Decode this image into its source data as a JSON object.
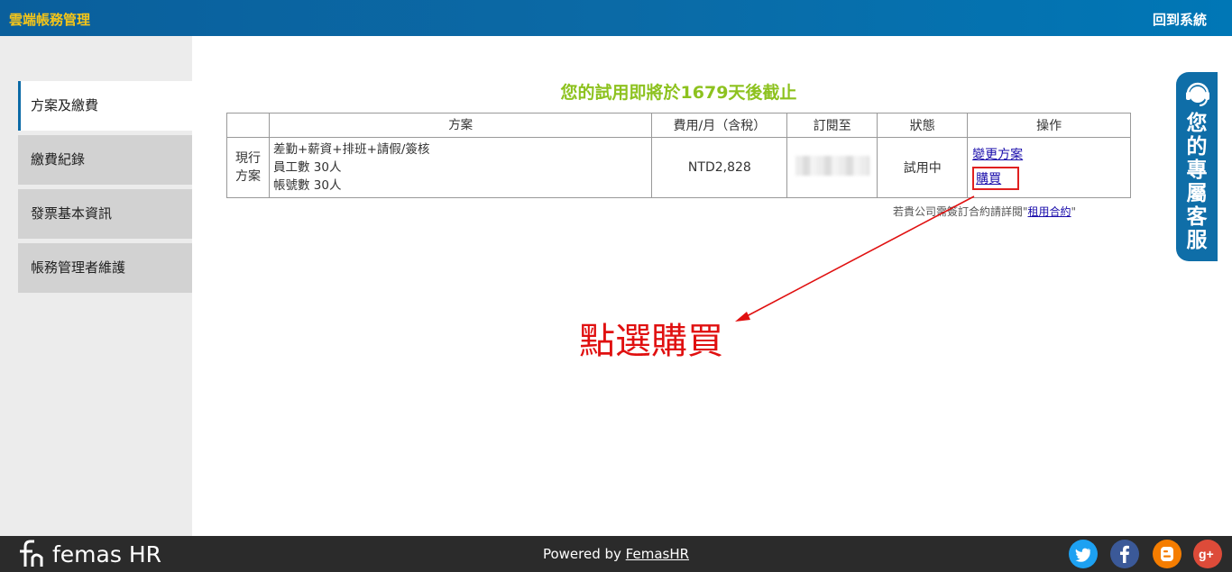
{
  "header": {
    "title": "雲端帳務管理",
    "back_label": "回到系統"
  },
  "sidebar": {
    "items": [
      {
        "label": "方案及繳費"
      },
      {
        "label": "繳費紀錄"
      },
      {
        "label": "發票基本資訊"
      },
      {
        "label": "帳務管理者維護"
      }
    ]
  },
  "main": {
    "trial_message": "您的試用即將於1679天後截止",
    "table": {
      "headers": [
        "",
        "方案",
        "費用/月（含稅）",
        "訂閱至",
        "狀態",
        "操作"
      ],
      "row": {
        "label": "現行方案",
        "plan_lines": [
          "差勤+薪資+排班+請假/簽核",
          "員工數 30人",
          "帳號數 30人"
        ],
        "fee": "NTD2,828",
        "status": "試用中",
        "change_label": "變更方案",
        "buy_label": "購買"
      }
    },
    "contract_note": {
      "prefix": "若貴公司需簽訂合約請詳閱\"",
      "link": "租用合約",
      "suffix": "\""
    },
    "annotation": "點選購買"
  },
  "customer_service": {
    "label": "您的專屬客服"
  },
  "footer": {
    "logo_text": "femas HR",
    "powered_prefix": "Powered by ",
    "powered_brand": "FemasHR",
    "social": [
      "twitter-icon",
      "facebook-icon",
      "blogger-icon",
      "google-plus-icon"
    ]
  },
  "colors": {
    "header_blue": "#0b6aa6",
    "title_yellow": "#f5c518",
    "trial_green": "#8dc21f",
    "annotation_red": "#e01010"
  }
}
